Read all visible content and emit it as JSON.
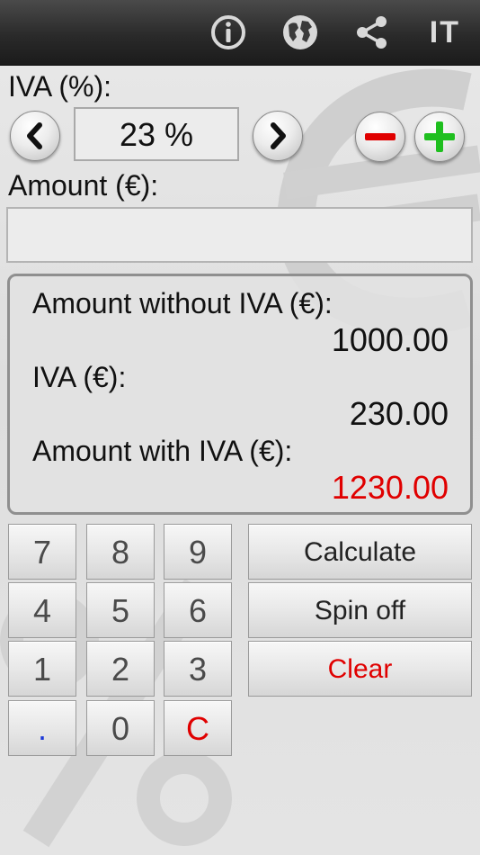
{
  "topbar": {
    "icons": [
      "info-icon",
      "globe-icon",
      "share-icon"
    ],
    "language": "IT"
  },
  "iva": {
    "label": "IVA (%):",
    "value": "23 %"
  },
  "amount": {
    "label": "Amount (€):",
    "value": "",
    "placeholder": ""
  },
  "results": {
    "without_label": "Amount without IVA (€):",
    "without_value": "1000.00",
    "iva_label": "IVA (€):",
    "iva_value": "230.00",
    "with_label": "Amount with IVA (€):",
    "with_value": "1230.00"
  },
  "keypad": {
    "rows": [
      [
        "7",
        "8",
        "9"
      ],
      [
        "4",
        "5",
        "6"
      ],
      [
        "1",
        "2",
        "3"
      ],
      [
        ".",
        "0",
        "C"
      ]
    ]
  },
  "actions": {
    "calculate": "Calculate",
    "spin_off": "Spin off",
    "clear": "Clear"
  },
  "colors": {
    "topbar": "#2a2a2a",
    "accent_red": "#e00000",
    "plus_green": "#1fbf1f",
    "minus_red": "#e00000",
    "dot_blue": "#1b38d8"
  }
}
